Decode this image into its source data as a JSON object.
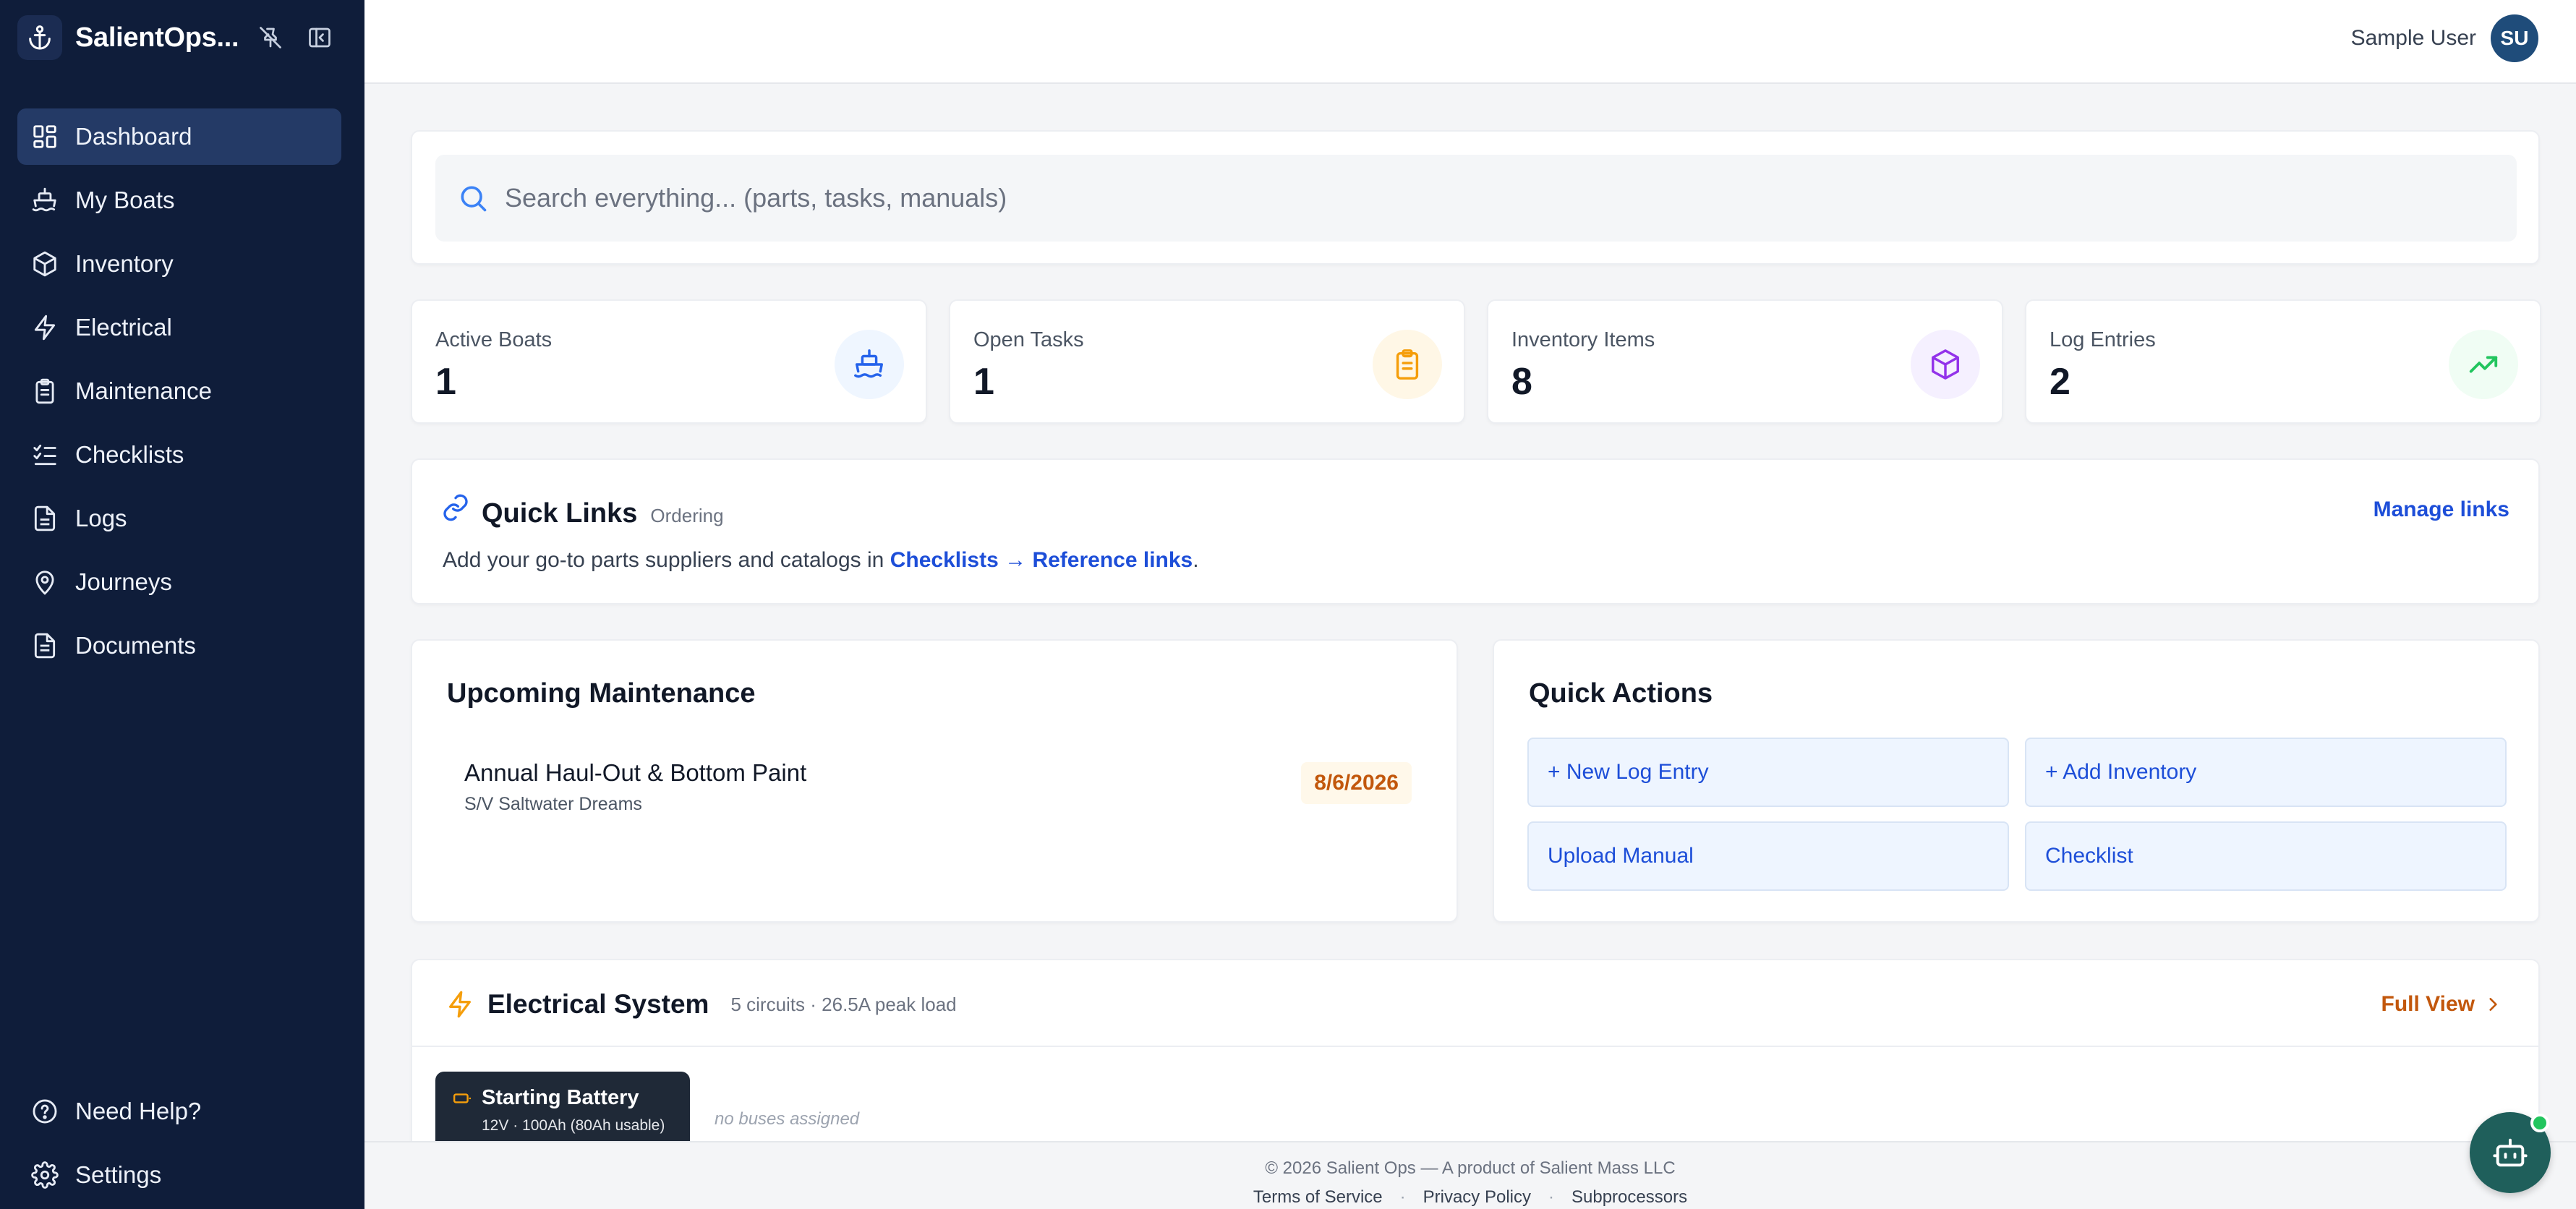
{
  "app": {
    "brand_name": "SalientOps...",
    "logo_icon": "anchor-icon"
  },
  "sidebar": {
    "items": [
      {
        "label": "Dashboard",
        "icon": "dashboard-icon",
        "active": true
      },
      {
        "label": "My Boats",
        "icon": "boat-icon"
      },
      {
        "label": "Inventory",
        "icon": "box-icon"
      },
      {
        "label": "Electrical",
        "icon": "lightning-icon"
      },
      {
        "label": "Maintenance",
        "icon": "clipboard-icon"
      },
      {
        "label": "Checklists",
        "icon": "checklist-icon"
      },
      {
        "label": "Logs",
        "icon": "document-icon"
      },
      {
        "label": "Journeys",
        "icon": "map-pin-icon"
      },
      {
        "label": "Documents",
        "icon": "file-icon"
      }
    ],
    "bottom": [
      {
        "label": "Need Help?",
        "icon": "help-icon"
      },
      {
        "label": "Settings",
        "icon": "gear-icon"
      }
    ]
  },
  "header": {
    "user_name": "Sample User",
    "avatar_initials": "SU"
  },
  "search": {
    "placeholder": "Search everything... (parts, tasks, manuals)"
  },
  "stats": [
    {
      "label": "Active Boats",
      "value": "1",
      "icon": "boat-icon",
      "color": "#2563eb"
    },
    {
      "label": "Open Tasks",
      "value": "1",
      "icon": "clipboard-icon",
      "color": "#f59e0b"
    },
    {
      "label": "Inventory Items",
      "value": "8",
      "icon": "box-icon",
      "color": "#9333ea"
    },
    {
      "label": "Log Entries",
      "value": "2",
      "icon": "trending-up-icon",
      "color": "#22c55e"
    }
  ],
  "quick_links": {
    "title": "Quick Links",
    "subtitle": "Ordering",
    "manage_label": "Manage links",
    "desc_prefix": "Add your go-to parts suppliers and catalogs in ",
    "desc_link": "Checklists → Reference links",
    "desc_suffix": "."
  },
  "maintenance": {
    "title": "Upcoming Maintenance",
    "items": [
      {
        "title": "Annual Haul-Out & Bottom Paint",
        "boat": "S/V Saltwater Dreams",
        "date": "8/6/2026"
      }
    ]
  },
  "quick_actions": {
    "title": "Quick Actions",
    "buttons": [
      "+ New Log Entry",
      "+ Add Inventory",
      "Upload Manual",
      "Checklist"
    ]
  },
  "electrical": {
    "title": "Electrical System",
    "subtitle": "5 circuits · 26.5A peak load",
    "full_view_label": "Full View",
    "battery": {
      "name": "Starting Battery",
      "spec": "12V · 100Ah (80Ah usable)"
    },
    "no_buses": "no buses assigned"
  },
  "footer": {
    "copyright": "© 2026 Salient Ops — A product of Salient Mass LLC",
    "links": [
      "Terms of Service",
      "Privacy Policy",
      "Subprocessors"
    ]
  },
  "colors": {
    "sidebar_bg": "#0f1d3a",
    "accent_blue": "#1d4ed8",
    "accent_orange": "#c2570c"
  }
}
